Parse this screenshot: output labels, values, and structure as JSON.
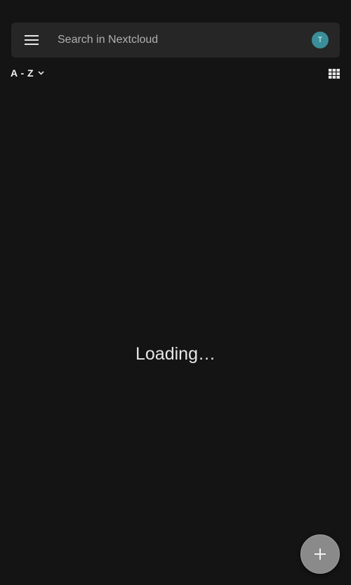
{
  "header": {
    "search_placeholder": "Search in Nextcloud",
    "avatar_initial": "T",
    "avatar_color": "#3a8e99"
  },
  "toolbar": {
    "sort_label": "A - Z",
    "view_mode_icon": "grid-icon"
  },
  "main": {
    "status_text": "Loading…"
  },
  "fab": {
    "icon": "plus-icon"
  }
}
